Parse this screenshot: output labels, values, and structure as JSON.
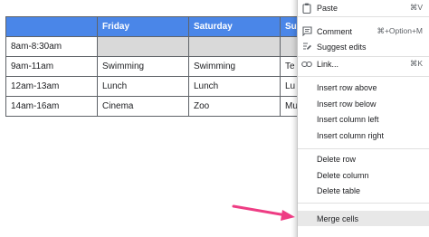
{
  "table": {
    "header": {
      "friday": "Friday",
      "saturday": "Saturday",
      "sunday_partial": "Su"
    },
    "rows": [
      {
        "time": "8am-8:30am",
        "friday": "",
        "saturday": "",
        "sunday": ""
      },
      {
        "time": "9am-11am",
        "friday": "Swimming",
        "saturday": "Swimming",
        "sunday": "Te"
      },
      {
        "time": "12am-13am",
        "friday": "Lunch",
        "saturday": "Lunch",
        "sunday": "Lu"
      },
      {
        "time": "14am-16am",
        "friday": "Cinema",
        "saturday": "Zoo",
        "sunday": "Mu"
      }
    ]
  },
  "context_menu": {
    "paste": {
      "label": "Paste",
      "shortcut": "⌘V",
      "icon": "clipboard-icon"
    },
    "comment": {
      "label": "Comment",
      "shortcut": "⌘+Option+M",
      "icon": "comment-icon"
    },
    "suggest_edits": {
      "label": "Suggest edits",
      "icon": "suggest-edits-icon"
    },
    "link": {
      "label": "Link...",
      "shortcut": "⌘K",
      "icon": "link-icon"
    },
    "insert_row_above": "Insert row above",
    "insert_row_below": "Insert row below",
    "insert_column_left": "Insert column left",
    "insert_column_right": "Insert column right",
    "delete_row": "Delete row",
    "delete_column": "Delete column",
    "delete_table": "Delete table",
    "merge_cells": "Merge cells"
  },
  "colors": {
    "header_blue": "#4a86e8",
    "grey_row": "#d9d9d9",
    "arrow_pink": "#ee3d84"
  }
}
